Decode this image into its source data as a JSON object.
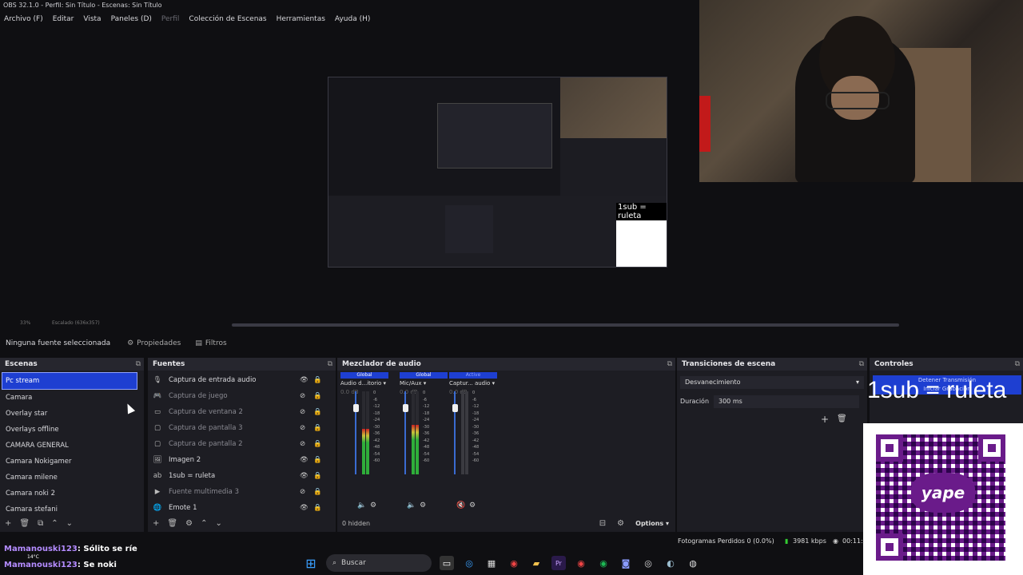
{
  "window": {
    "title": "OBS 32.1.0 - Perfil: Sin Título - Escenas: Sin Título"
  },
  "menu": [
    "Archivo (F)",
    "Editar",
    "Vista",
    "Paneles (D)",
    "Perfil",
    "Colección de Escenas",
    "Herramientas",
    "Ayuda (H)"
  ],
  "preview": {
    "zoom": "33%",
    "scale": "Escalado (636x357)",
    "overlay_text": "1sub = ruleta"
  },
  "source_toolbar": {
    "status": "Ninguna fuente seleccionada",
    "properties": "Propiedades",
    "filters": "Filtros"
  },
  "scenes": {
    "title": "Escenas",
    "items": [
      "Pc stream",
      "Camara",
      "Overlay star",
      "Overlays offline",
      "CAMARA GENERAL",
      "Camara Nokigamer",
      "Camara milene",
      "Camara noki 2",
      "Camara stefani"
    ],
    "selected": "Pc stream"
  },
  "sources": {
    "title": "Fuentes",
    "items": [
      {
        "label": "Captura de entrada audio",
        "icon": "mic-icon",
        "visible": true
      },
      {
        "label": "Captura de juego",
        "icon": "gamepad-icon",
        "visible": false
      },
      {
        "label": "Captura de ventana 2",
        "icon": "window-icon",
        "visible": false
      },
      {
        "label": "Captura de pantalla 3",
        "icon": "monitor-icon",
        "visible": false
      },
      {
        "label": "Captura de pantalla 2",
        "icon": "monitor-icon",
        "visible": false
      },
      {
        "label": "Imagen 2",
        "icon": "image-icon",
        "visible": true
      },
      {
        "label": "1sub = ruleta",
        "icon": "text-icon",
        "visible": true
      },
      {
        "label": "Fuente multimedia 3",
        "icon": "play-icon",
        "visible": false
      },
      {
        "label": "Emote 1",
        "icon": "browser-icon",
        "visible": true
      }
    ]
  },
  "mixer": {
    "title": "Mezclador de audio",
    "channels": [
      {
        "tag": "Global",
        "name": "Audio d...itorio",
        "db": "0.0 dB",
        "level": 0.55
      },
      {
        "tag": "Global",
        "name": "Mic/Aux",
        "db": "0.0 dB",
        "level": 0.6
      },
      {
        "tag": "Active",
        "name": "Captur... audio",
        "db": "0.0 dB",
        "level": 0.0
      }
    ],
    "scale": [
      "0",
      "-6",
      "-12",
      "-18",
      "-24",
      "-30",
      "-36",
      "-42",
      "-48",
      "-54",
      "-60"
    ],
    "hidden": "0 hidden",
    "options": "Options"
  },
  "transitions": {
    "title": "Transiciones de escena",
    "selected": "Desvanecimiento",
    "duration_label": "Duración",
    "duration_value": "300 ms"
  },
  "controls": {
    "title": "Controles",
    "stop_stream": "Detener Transmisión",
    "start_record": "Iniciar Grabación"
  },
  "status": {
    "dropped": "Fotogramas Perdidos 0 (0.0%)",
    "bitrate": "3981 kbps",
    "time": "00:11:"
  },
  "chat": [
    {
      "user": "Mamanouski123",
      "message": "Sólito se ríe"
    },
    {
      "user": "Mamanouski123",
      "message": "Se noki"
    }
  ],
  "taskbar": {
    "search": "Buscar",
    "weather": "14°C"
  }
}
